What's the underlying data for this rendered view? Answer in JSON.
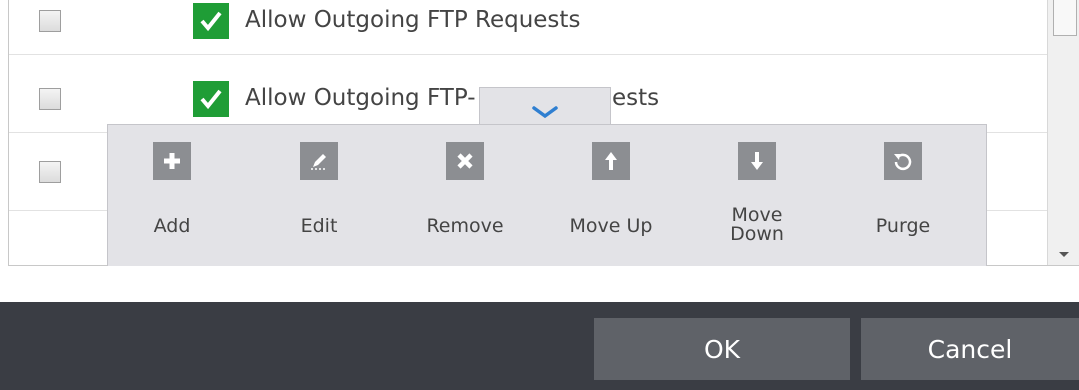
{
  "rules": [
    {
      "label": "Allow Outgoing FTP Requests",
      "enabled": true
    },
    {
      "label": "Allow Outgoing FTP-",
      "label_tail": "ests",
      "enabled": true
    },
    {
      "label": "",
      "enabled": false
    }
  ],
  "toolbar": {
    "collapse_icon": "chevron-down-icon",
    "buttons": [
      {
        "label": "Add",
        "icon": "plus-icon"
      },
      {
        "label": "Edit",
        "icon": "pencil-icon"
      },
      {
        "label": "Remove",
        "icon": "x-icon"
      },
      {
        "label": "Move Up",
        "icon": "arrow-up-icon"
      },
      {
        "label": "Move\nDown",
        "icon": "arrow-down-icon"
      },
      {
        "label": "Purge",
        "icon": "refresh-icon"
      }
    ]
  },
  "footer": {
    "ok_label": "OK",
    "cancel_label": "Cancel"
  },
  "colors": {
    "enabled_green": "#1f9d36",
    "toolbar_bg": "#e3e3e7",
    "icon_gray": "#8c8e92",
    "footer_bg": "#3a3d44",
    "footer_button": "#5f6268",
    "chevron_blue": "#2f7fd1"
  }
}
